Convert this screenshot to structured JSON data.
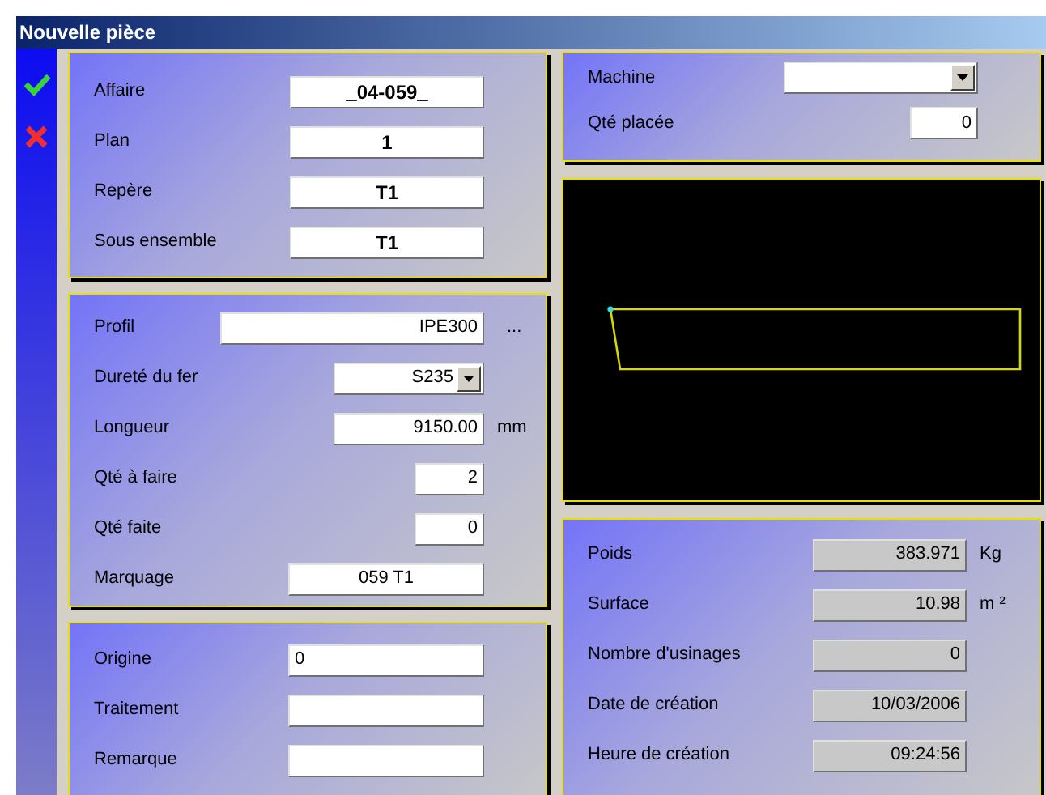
{
  "window": {
    "title": "Nouvelle pièce"
  },
  "left_panels": [
    {
      "fields": [
        {
          "label": "Affaire",
          "kind": "code",
          "value": "_04-059_"
        },
        {
          "label": "Plan",
          "kind": "code",
          "value": "1"
        },
        {
          "label": "Repère",
          "kind": "code",
          "value": "T1"
        },
        {
          "label": "Sous ensemble",
          "kind": "code",
          "value": "T1"
        }
      ]
    },
    {
      "fields": [
        {
          "label": "Profil",
          "kind": "number",
          "value": "IPE300",
          "button": "..."
        },
        {
          "label": "Dureté du fer",
          "kind": "combo",
          "value": "S235"
        },
        {
          "label": "Longueur",
          "kind": "number",
          "value": "9150.00",
          "unit": "mm"
        },
        {
          "label": "Qté à faire",
          "kind": "number",
          "value": "2"
        },
        {
          "label": "Qté faite",
          "kind": "number",
          "value": "0"
        },
        {
          "label": "Marquage",
          "kind": "centered",
          "value": "059 T1"
        }
      ]
    },
    {
      "fields": [
        {
          "label": "Origine",
          "kind": "free",
          "value": "0"
        },
        {
          "label": "Traitement",
          "kind": "free"
        },
        {
          "label": "Remarque",
          "kind": "free"
        }
      ]
    }
  ],
  "right_panels": [
    {
      "fields": [
        {
          "label": "Machine",
          "kind": "combo"
        },
        {
          "label": "Qté placée",
          "kind": "number",
          "value": "0"
        }
      ]
    },
    {
      "fields": [
        {
          "label": "Poids",
          "kind": "readonly",
          "value": "383.971",
          "unit": "Kg"
        },
        {
          "label": "Surface",
          "kind": "readonly",
          "value": "10.98",
          "unit": "m ²"
        },
        {
          "label": "Nombre d'usinages",
          "kind": "readonly",
          "value": "0"
        },
        {
          "label": "Date de création",
          "kind": "readonly",
          "value": "10/03/2006"
        },
        {
          "label": "Heure de création",
          "kind": "readonly",
          "value": "09:24:56"
        }
      ]
    }
  ]
}
